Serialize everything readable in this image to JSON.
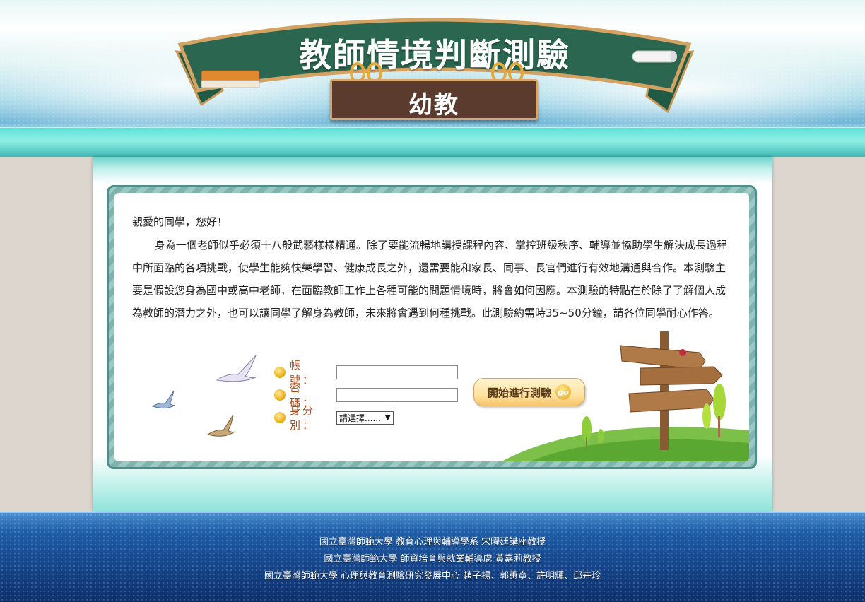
{
  "header": {
    "title": "教師情境判斷測驗",
    "subtitle": "幼教"
  },
  "main": {
    "greeting": "親愛的同學，您好！",
    "intro": "身為一個老師似乎必須十八般武藝樣樣精通。除了要能流暢地講授課程內容、掌控班級秩序、輔導並協助學生解決成長過程中所面臨的各項挑戰，使學生能夠快樂學習、健康成長之外，還需要能和家長、同事、長官們進行有效地溝通與合作。本測驗主要是假設您身為國中或高中老師，在面臨教師工作上各種可能的問題情境時，將會如何因應。本測驗的特點在於除了了解個人成為教師的潛力之外，也可以讓同學了解身為教師，未來將會遇到何種挑戰。此測驗約需時35~50分鐘，請各位同學耐心作答。"
  },
  "form": {
    "account_label": "帳　號：",
    "account_value": "",
    "password_label": "密　碼：",
    "password_value": "",
    "identity_label": "身分別：",
    "identity_selected": "請選擇......",
    "start_button": "開始進行測驗",
    "go_icon_text": "go"
  },
  "footer": {
    "lines": [
      "國立臺灣師範大學 教育心理與輔導學系 宋曜廷講座教授",
      "國立臺灣師範大學 師資培育與就業輔導處 黃嘉莉教授",
      "國立臺灣師範大學 心理與教育測驗研究發展中心 趙子揚、郭蕙寧、許明輝、邱卉珍"
    ]
  },
  "colors": {
    "banner_green": "#2a6650",
    "board_brown": "#5c3b2f",
    "teal_band": "#5fe0d8",
    "footer_blue": "#15448a",
    "label_orange": "#b24a1a"
  },
  "icons": [
    "bird-icon",
    "signpost-icon",
    "chalk-eraser-icon",
    "chalk-icon",
    "bullet-icon"
  ]
}
